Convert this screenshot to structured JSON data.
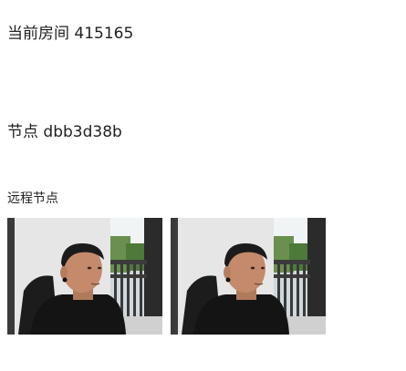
{
  "room": {
    "label": "当前房间",
    "id": "415165"
  },
  "node": {
    "label": "节点",
    "id": "dbb3d38b"
  },
  "remote": {
    "label": "远程节点",
    "videos": [
      {
        "kind": "remote-video-feed"
      },
      {
        "kind": "remote-video-feed"
      }
    ]
  }
}
